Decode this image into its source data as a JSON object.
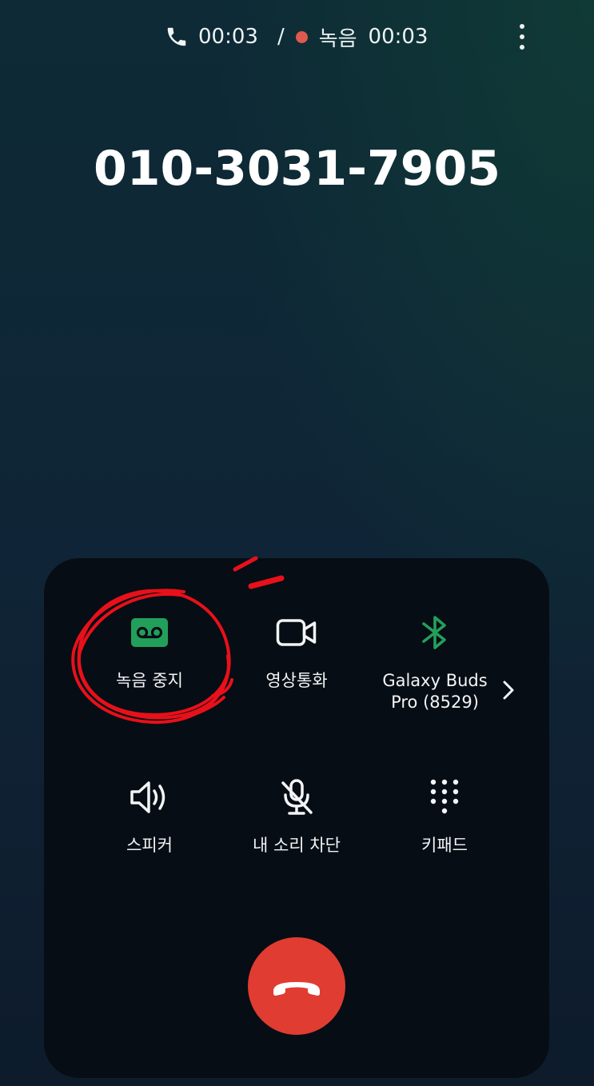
{
  "status": {
    "call_timer": "00:03",
    "separator": "/",
    "recording_label": "녹음",
    "recording_timer": "00:03"
  },
  "caller": {
    "number": "010-3031-7905"
  },
  "controls": {
    "record_stop": "녹음 중지",
    "video_call": "영상통화",
    "bluetooth_device": "Galaxy Buds\nPro (8529)",
    "speaker": "스피커",
    "mute": "내 소리 차단",
    "keypad": "키패드"
  },
  "icons": {
    "status_phone": "phone-icon",
    "recording_dot": "recording-dot",
    "more": "more-options-icon",
    "record_stop": "voicemail-icon",
    "video_call": "video-camera-icon",
    "bluetooth": "bluetooth-icon",
    "device_chevron": "chevron-right-icon",
    "speaker": "speaker-icon",
    "mute": "mic-off-icon",
    "keypad": "dialpad-icon",
    "end_call": "end-call-icon"
  },
  "colors": {
    "accent_green": "#22a05b",
    "recording_dot": "#e0594f",
    "end_call": "#e03c31",
    "annotation_red": "#e8101a",
    "panel": "#070d14"
  }
}
